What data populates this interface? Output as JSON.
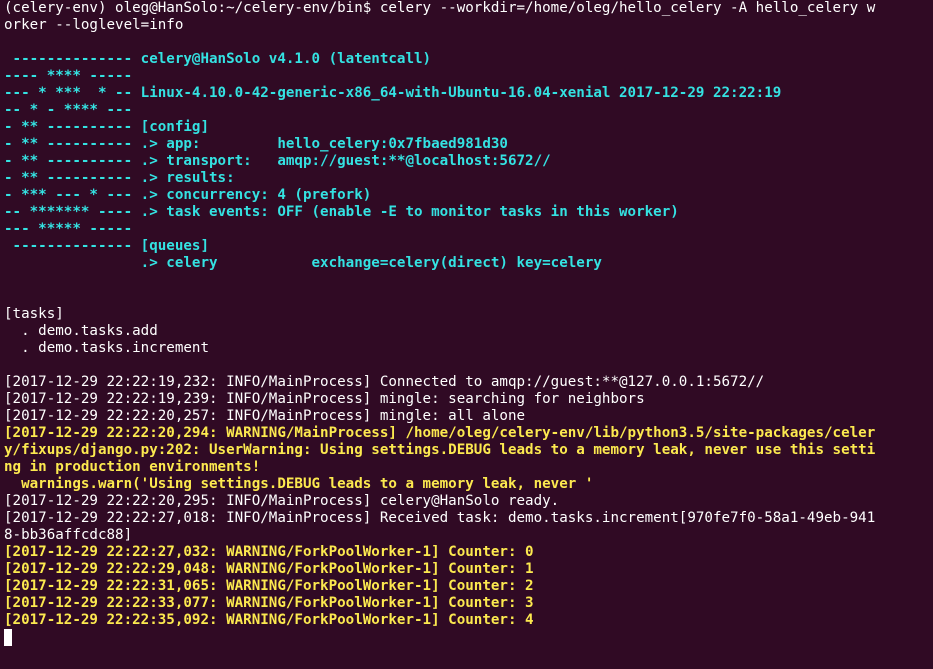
{
  "lines": [
    {
      "text": "(celery-env) oleg@HanSolo:~/celery-env/bin$ celery --workdir=/home/oleg/hello_celery -A hello_celery w",
      "color": "w"
    },
    {
      "text": "orker --loglevel=info",
      "color": "w"
    },
    {
      "text": "",
      "color": "w"
    },
    {
      "text": " -------------- celery@HanSolo v4.1.0 (latentcall)",
      "color": "c"
    },
    {
      "text": "---- **** -----",
      "color": "c"
    },
    {
      "text": "--- * ***  * -- Linux-4.10.0-42-generic-x86_64-with-Ubuntu-16.04-xenial 2017-12-29 22:22:19",
      "color": "c"
    },
    {
      "text": "-- * - **** ---",
      "color": "c"
    },
    {
      "text": "- ** ---------- [config]",
      "color": "c"
    },
    {
      "text": "- ** ---------- .> app:         hello_celery:0x7fbaed981d30",
      "color": "c"
    },
    {
      "text": "- ** ---------- .> transport:   amqp://guest:**@localhost:5672//",
      "color": "c"
    },
    {
      "text": "- ** ---------- .> results:",
      "color": "c"
    },
    {
      "text": "- *** --- * --- .> concurrency: 4 (prefork)",
      "color": "c"
    },
    {
      "text": "-- ******* ---- .> task events: OFF (enable -E to monitor tasks in this worker)",
      "color": "c"
    },
    {
      "text": "--- ***** -----",
      "color": "c"
    },
    {
      "text": " -------------- [queues]",
      "color": "c"
    },
    {
      "text": "                .> celery           exchange=celery(direct) key=celery",
      "color": "c"
    },
    {
      "text": "",
      "color": "w"
    },
    {
      "text": "",
      "color": "w"
    },
    {
      "text": "[tasks]",
      "color": "w"
    },
    {
      "text": "  . demo.tasks.add",
      "color": "w"
    },
    {
      "text": "  . demo.tasks.increment",
      "color": "w"
    },
    {
      "text": "",
      "color": "w"
    },
    {
      "text": "[2017-12-29 22:22:19,232: INFO/MainProcess] Connected to amqp://guest:**@127.0.0.1:5672//",
      "color": "w"
    },
    {
      "text": "[2017-12-29 22:22:19,239: INFO/MainProcess] mingle: searching for neighbors",
      "color": "w"
    },
    {
      "text": "[2017-12-29 22:22:20,257: INFO/MainProcess] mingle: all alone",
      "color": "w"
    },
    {
      "text": "[2017-12-29 22:22:20,294: WARNING/MainProcess] /home/oleg/celery-env/lib/python3.5/site-packages/celer",
      "color": "y"
    },
    {
      "text": "y/fixups/django.py:202: UserWarning: Using settings.DEBUG leads to a memory leak, never use this setti",
      "color": "y"
    },
    {
      "text": "ng in production environments!",
      "color": "y"
    },
    {
      "text": "  warnings.warn('Using settings.DEBUG leads to a memory leak, never '",
      "color": "y"
    },
    {
      "text": "[2017-12-29 22:22:20,295: INFO/MainProcess] celery@HanSolo ready.",
      "color": "w"
    },
    {
      "text": "[2017-12-29 22:22:27,018: INFO/MainProcess] Received task: demo.tasks.increment[970fe7f0-58a1-49eb-941",
      "color": "w"
    },
    {
      "text": "8-bb36affcdc88]",
      "color": "w"
    },
    {
      "text": "[2017-12-29 22:22:27,032: WARNING/ForkPoolWorker-1] Counter: 0",
      "color": "y"
    },
    {
      "text": "[2017-12-29 22:22:29,048: WARNING/ForkPoolWorker-1] Counter: 1",
      "color": "y"
    },
    {
      "text": "[2017-12-29 22:22:31,065: WARNING/ForkPoolWorker-1] Counter: 2",
      "color": "y"
    },
    {
      "text": "[2017-12-29 22:22:33,077: WARNING/ForkPoolWorker-1] Counter: 3",
      "color": "y"
    },
    {
      "text": "[2017-12-29 22:22:35,092: WARNING/ForkPoolWorker-1] Counter: 4",
      "color": "y"
    }
  ],
  "colors": {
    "background": "#300a24",
    "text": "#ffffff",
    "cyan": "#34e2e2",
    "yellow": "#fce94f"
  }
}
